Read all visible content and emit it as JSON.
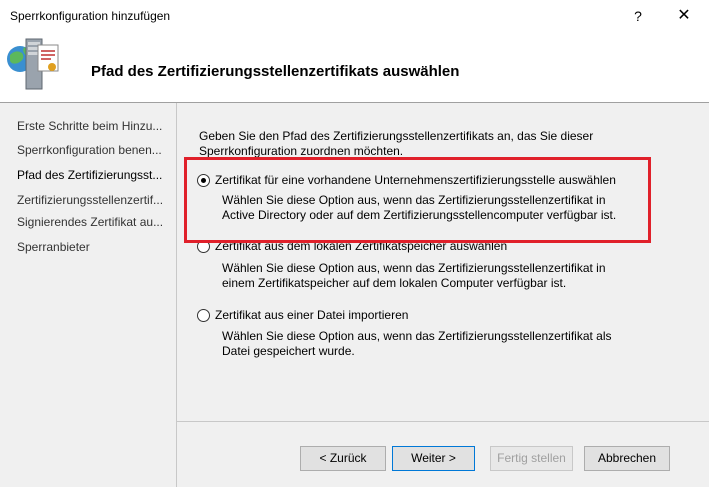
{
  "window": {
    "title": "Sperrkonfiguration hinzufügen",
    "help_label": "?",
    "close_label": "✕"
  },
  "header": {
    "heading": "Pfad des Zertifizierungsstellenzertifikats auswählen",
    "icon": "server-certificate-icon"
  },
  "sidebar": {
    "items": [
      {
        "label": "Erste Schritte beim Hinzu...",
        "active": false
      },
      {
        "label": "Sperrkonfiguration benen...",
        "active": false
      },
      {
        "label": "Pfad des Zertifizierungsst...",
        "active": true
      },
      {
        "label": "Zertifizierungsstellenzertif...",
        "active": false
      },
      {
        "label": "Signierendes Zertifikat au...",
        "active": false
      },
      {
        "label": "Sperranbieter",
        "active": false
      }
    ]
  },
  "main": {
    "intro": "Geben Sie den Pfad des Zertifizierungsstellenzertifikats an, das Sie dieser Sperrkonfiguration zuordnen möchten.",
    "options": [
      {
        "label": "Zertifikat für eine vorhandene Unternehmenszertifizierungsstelle auswählen",
        "description": "Wählen Sie diese Option aus, wenn das Zertifizierungsstellenzertifikat in Active Directory oder auf dem Zertifizierungsstellencomputer verfügbar ist.",
        "selected": true
      },
      {
        "label": "Zertifikat aus dem lokalen Zertifikatspeicher auswählen",
        "description": "Wählen Sie diese Option aus, wenn das Zertifizierungsstellenzertifikat in einem Zertifikatspeicher auf dem lokalen Computer verfügbar ist.",
        "selected": false
      },
      {
        "label": "Zertifikat aus einer Datei importieren",
        "description": "Wählen Sie diese Option aus, wenn das Zertifizierungsstellenzertifikat als Datei gespeichert wurde.",
        "selected": false
      }
    ],
    "highlight_color": "#e0202a"
  },
  "buttons": {
    "back": "< Zurück",
    "next": "Weiter >",
    "finish": "Fertig stellen",
    "cancel": "Abbrechen"
  },
  "colors": {
    "panel": "#f0f0f0",
    "accent": "#0078d7"
  }
}
